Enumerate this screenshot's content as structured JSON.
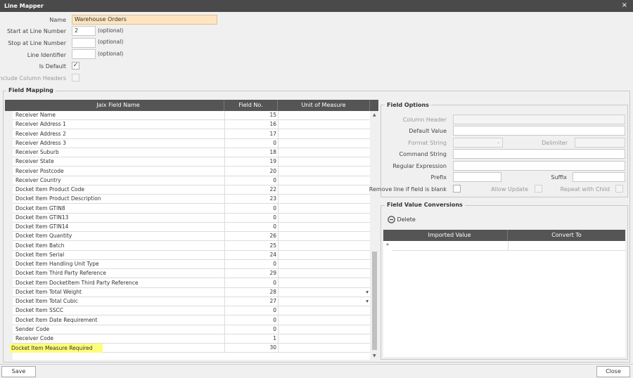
{
  "window": {
    "title": "Line Mapper",
    "close_glyph": "×"
  },
  "form": {
    "name_label": "Name",
    "name_value": "Warehouse Orders",
    "start_label": "Start at Line Number",
    "start_value": "2",
    "start_hint": "(optional)",
    "stop_label": "Stop at Line Number",
    "stop_value": "",
    "stop_hint": "(optional)",
    "identifier_label": "Line Identifier",
    "identifier_value": "",
    "identifier_hint": "(optional)",
    "default_label": "Is Default",
    "default_check": "✓",
    "headers_label": "Include Column Headers"
  },
  "field_mapping": {
    "title": "Field Mapping",
    "columns": [
      "Jaix Field Name",
      "Field No.",
      "Unit of Measure"
    ],
    "rows": [
      {
        "name": "Receiver Name",
        "no": "15",
        "uom": ""
      },
      {
        "name": "Receiver Address 1",
        "no": "16",
        "uom": ""
      },
      {
        "name": "Receiver Address 2",
        "no": "17",
        "uom": ""
      },
      {
        "name": "Receiver Address 3",
        "no": "0",
        "uom": ""
      },
      {
        "name": "Receiver Suburb",
        "no": "18",
        "uom": ""
      },
      {
        "name": "Receiver State",
        "no": "19",
        "uom": ""
      },
      {
        "name": "Receiver Postcode",
        "no": "20",
        "uom": ""
      },
      {
        "name": "Receiver Country",
        "no": "0",
        "uom": ""
      },
      {
        "name": "Docket Item Product Code",
        "no": "22",
        "uom": ""
      },
      {
        "name": "Docket Item Product Description",
        "no": "23",
        "uom": ""
      },
      {
        "name": "Docket Item GTIN8",
        "no": "0",
        "uom": ""
      },
      {
        "name": "Docket Item GTIN13",
        "no": "0",
        "uom": ""
      },
      {
        "name": "Docket Item GTIN14",
        "no": "0",
        "uom": ""
      },
      {
        "name": "Docket Item Quantity",
        "no": "26",
        "uom": ""
      },
      {
        "name": "Docket Item Batch",
        "no": "25",
        "uom": ""
      },
      {
        "name": "Docket Item Serial",
        "no": "24",
        "uom": ""
      },
      {
        "name": "Docket Item Handling Unit Type",
        "no": "0",
        "uom": ""
      },
      {
        "name": "Docket Item Third Party Reference",
        "no": "29",
        "uom": ""
      },
      {
        "name": "Docket Item DocketItem Third Party Reference",
        "no": "0",
        "uom": ""
      },
      {
        "name": "Docket Item Total Weight",
        "no": "28",
        "uom": "▾"
      },
      {
        "name": "Docket Item Total Cubic",
        "no": "27",
        "uom": "▾"
      },
      {
        "name": "Docket Item SSCC",
        "no": "0",
        "uom": ""
      },
      {
        "name": "Docket Item Date Requirement",
        "no": "0",
        "uom": ""
      },
      {
        "name": "Sender Code",
        "no": "0",
        "uom": ""
      },
      {
        "name": "Receiver Code",
        "no": "1",
        "uom": ""
      },
      {
        "name": "Docket Item Measure Required",
        "no": "30",
        "uom": "",
        "highlight": true
      }
    ]
  },
  "field_options": {
    "title": "Field Options",
    "column_header_label": "Column Header",
    "default_value_label": "Default Value",
    "format_string_label": "Format String",
    "delimiter_label": "Delimiter",
    "command_string_label": "Command String",
    "regex_label": "Regular Expression",
    "prefix_label": "Prefix",
    "suffix_label": "Suffix",
    "remove_blank_label": "Remove line if field is blank",
    "allow_update_label": "Allow Update",
    "repeat_child_label": "Repeat with Child"
  },
  "conversions": {
    "title": "Field Value Conversions",
    "delete_label": "Delete",
    "columns": [
      "Imported Value",
      "Convert To"
    ],
    "new_row_marker": "*"
  },
  "footer": {
    "save_label": "Save",
    "close_label": "Close"
  }
}
